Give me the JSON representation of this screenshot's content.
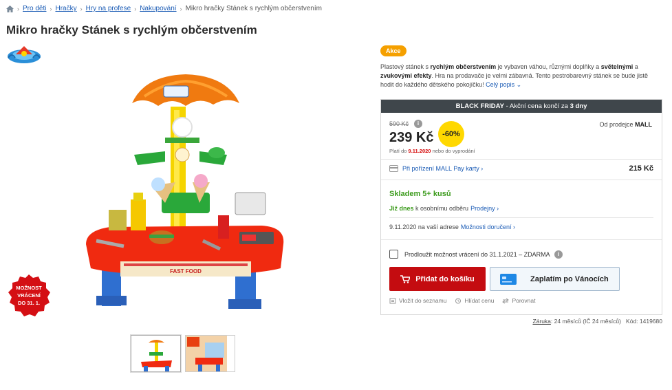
{
  "breadcrumb": {
    "items": [
      "Pro děti",
      "Hračky",
      "Hry na profese",
      "Nakupování"
    ],
    "current": "Mikro hračky Stánek s rychlým občerstvením"
  },
  "product": {
    "title": "Mikro hračky Stánek s rychlým občerstvením",
    "badge_return": [
      "MOŽNOST",
      "VRÁCENÍ",
      "DO 31. 1."
    ],
    "image_label": "FAST FOOD"
  },
  "tag": "Akce",
  "description": {
    "p1": "Plastový stánek s ",
    "b1": "rychlým občerstvením",
    "p2": " je vybaven váhou, různými doplňky a ",
    "b2": "světelnými",
    "p3": " a ",
    "b3": "zvukovými efekty",
    "p4": ". Hra na prodavače je velmi zábavná. Tento pestrobarevný stánek se bude jistě hodit do každého dětského pokojíčku! ",
    "more": "Celý popis"
  },
  "offer": {
    "bf_label": "BLACK FRIDAY",
    "bf_text": " - Akční cena končí za ",
    "bf_days": "3 dny",
    "old_price": "590 Kč",
    "price": "239 Kč",
    "discount": "-60%",
    "valid_prefix": "Platí do ",
    "valid_date": "9.11.2020",
    "valid_suffix": " nebo do vyprodání",
    "seller_prefix": "Od prodejce ",
    "seller_name": "MALL",
    "mallpay_label": "Při pořízení MALL Pay karty",
    "mallpay_price": "215 Kč",
    "stock": "Skladem 5+ kusů",
    "pickup_today": "Již dnes",
    "pickup_text": " k osobnímu odběru",
    "pickup_link": "Prodejny",
    "delivery_text": "9.11.2020 na vaší adrese",
    "delivery_link": "Možnosti doručení",
    "extend_label": "Prodloužit možnost vrácení do 31.1.2021 – ZDARMA",
    "add_to_cart": "Přidat do košíku",
    "pay_christmas": "Zaplatím po Vánocích",
    "action_wishlist": "Vložit do seznamu",
    "action_watch": "Hlídat cenu",
    "action_compare": "Porovnat"
  },
  "footer": {
    "warranty_link": "Záruka",
    "warranty_text": ": 24 měsíců (IČ 24 měsíců)",
    "code": "Kód: 1419680"
  },
  "colors": {
    "link": "#1a5bb5",
    "cart_button": "#c40c10",
    "stock_green": "#3a9a1a",
    "discount_yellow": "#ffd800",
    "tag_orange": "#f5a000",
    "bf_bar": "#3f464b"
  },
  "icons": [
    "home-icon",
    "info-icon",
    "card-icon",
    "cart-icon",
    "paycard-icon",
    "wishlist-icon",
    "watch-icon",
    "compare-icon"
  ]
}
